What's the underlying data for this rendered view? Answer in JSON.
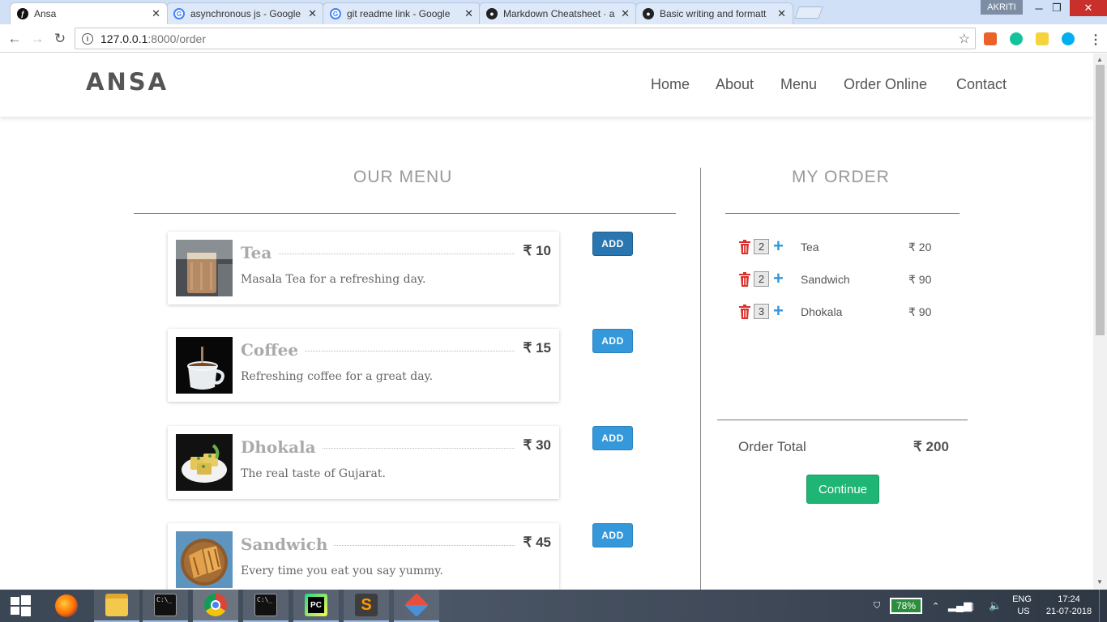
{
  "browser": {
    "tabs": [
      {
        "title": "Ansa",
        "favicon": "symfony-icon",
        "active": true
      },
      {
        "title": "asynchronous js - Google",
        "favicon": "google-icon",
        "active": false
      },
      {
        "title": "git readme link - Google",
        "favicon": "google-icon",
        "active": false
      },
      {
        "title": "Markdown Cheatsheet · a",
        "favicon": "github-icon",
        "active": false
      },
      {
        "title": "Basic writing and formatt",
        "favicon": "github-icon",
        "active": false
      }
    ],
    "profile_name": "AKRITI",
    "url_host": "127.0.0.1",
    "url_path": ":8000/order"
  },
  "site": {
    "logo": "ANSA",
    "nav": [
      "Home",
      "About",
      "Menu",
      "Order Online",
      "Contact"
    ]
  },
  "menu": {
    "title": "OUR MENU",
    "add_label": "ADD",
    "items": [
      {
        "name": "Tea",
        "price": "₹ 10",
        "description": "Masala Tea for a refreshing day."
      },
      {
        "name": "Coffee",
        "price": "₹ 15",
        "description": "Refreshing coffee for a great day."
      },
      {
        "name": "Dhokala",
        "price": "₹ 30",
        "description": "The real taste of Gujarat."
      },
      {
        "name": "Sandwich",
        "price": "₹ 45",
        "description": "Every time you eat you say yummy."
      }
    ]
  },
  "order": {
    "title": "MY ORDER",
    "items": [
      {
        "qty": "2",
        "name": "Tea",
        "price": "₹ 20"
      },
      {
        "qty": "2",
        "name": "Sandwich",
        "price": "₹ 90"
      },
      {
        "qty": "3",
        "name": "Dhokala",
        "price": "₹ 90"
      }
    ],
    "total_label": "Order Total",
    "total_value": "₹ 200",
    "continue_label": "Continue"
  },
  "taskbar": {
    "battery": "78%",
    "language": "ENG",
    "region": "US",
    "time": "17:24",
    "date": "21-07-2018"
  },
  "colors": {
    "accent_blue": "#3498db",
    "continue_green": "#1fb575",
    "trash_red": "#d9302c"
  }
}
